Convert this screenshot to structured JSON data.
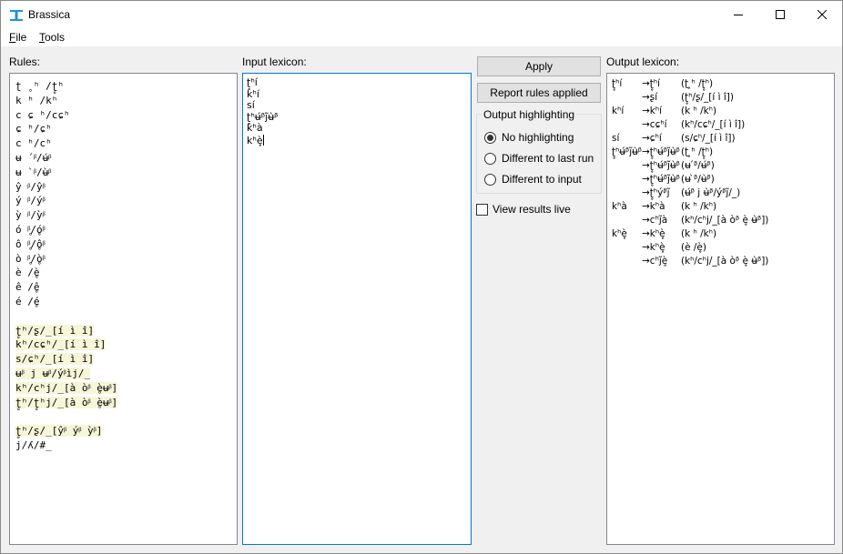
{
  "window": {
    "title": "Brassica",
    "minimize_glyph": "—",
    "maximize_glyph": "☐",
    "close_glyph": "✕"
  },
  "menu": {
    "file": {
      "accel": "F",
      "rest": "ile"
    },
    "tools": {
      "accel": "T",
      "rest": "ools"
    }
  },
  "rules": {
    "label": "Rules:",
    "lines": [
      "ʈ ̥ ʰ /ʈ̥ʰ",
      "k ʰ /kʰ",
      "c ɕ ʰ/cɕʰ",
      "ɕ ʰ/ɕʰ",
      "c ʰ/cʰ",
      "ʉ ́ ᵝ/ʉ́ᵝ",
      "ʉ ̀ ᵝ/ʉ̀ᵝ",
      "ŷ ᵝ/ŷᵝ",
      "ý ᵝ/ýᵝ",
      "ỳ ᵝ/ỳᵝ",
      "ó ̥ᵝ/ó̥ᵝ",
      "ô ̥ᵝ/ô̥ᵝ",
      "ò ̥ᵝ/ò̥ᵝ",
      "è /è̥",
      "ê /ê̥",
      "é /é̥",
      "",
      "ʈ̥ʰ/ʂ/_[í ì î]",
      "kʰ/cɕʰ/_[í ì î]",
      "s/ɕʰ/_[í ì î]",
      "ʉᵝ j ʉᵝ/ýᵝìj/_",
      "kʰ/cʰj/_[à òᵝ è̥ʉᵝ]",
      "ʈ̥ʰ/ʈ̥ʰj/_[à òᵝ è̥ʉᵝ]",
      "",
      "ʈ̥ʰ/ʂ/_[ŷᵝ ýᵝ ỳᵝ]",
      "j/ʎ/#_"
    ]
  },
  "input": {
    "label": "Input lexicon:",
    "lines": [
      "ʈ̥ʰí",
      "kʰí",
      "sí",
      "ʈ̥ʰʉ́ᵝj̃ʉ̀ᵝ",
      "kʰà",
      "kʰè̥"
    ]
  },
  "controls": {
    "apply_label": "Apply",
    "report_label": "Report rules applied",
    "highlight_group": "Output highlighting",
    "options": [
      "No highlighting",
      "Different to last run",
      "Different to input"
    ],
    "selected_option": "No highlighting",
    "live_label": "View results live",
    "live_checked": false
  },
  "output": {
    "label": "Output lexicon:",
    "rows": [
      {
        "word": "ʈ̥ʰí",
        "arrow": "→ʈ̥ʰí",
        "rule": "(ʈ ̥ʰ /ʈ̥ʰ)"
      },
      {
        "word": "",
        "arrow": "→ʂí",
        "rule": "(ʈ̥ʰ/ʂ/_[í ì î])"
      },
      {
        "word": "kʰí",
        "arrow": "→kʰí",
        "rule": "(k ʰ /kʰ)"
      },
      {
        "word": "",
        "arrow": "→cɕʰí",
        "rule": "(kʰ/cɕʰ/_[í ì î])"
      },
      {
        "word": "sí",
        "arrow": "→ɕʰí",
        "rule": "(s/ɕʰ/_[í ì î])"
      },
      {
        "word": "ʈ̥ʰʉ́ᵝj̃ʉ̀ᵝ",
        "arrow": "→ʈ̥ʰʉ́ᵝj̃ʉ̀ᵝ",
        "rule": "(ʈ ̥ʰ /ʈ̥ʰ)"
      },
      {
        "word": "",
        "arrow": "→ʈ̥ʰʉ́ᵝj̃ʉ̀ᵝ",
        "rule": "(ʉ ́ᵝ/ʉ́ᵝ)"
      },
      {
        "word": "",
        "arrow": "→ʈ̥ʰʉ́ᵝj̃ʉ̀ᵝ",
        "rule": "(ʉ ̀ᵝ/ʉ̀ᵝ)"
      },
      {
        "word": "",
        "arrow": "→ʈ̥ʰýᵝj̃",
        "rule": "(ʉ́ᵝ j ʉ̀ᵝ/ýᵝj̃/_)"
      },
      {
        "word": "kʰà",
        "arrow": "→kʰà",
        "rule": "(k ʰ /kʰ)"
      },
      {
        "word": "",
        "arrow": "→cʰj̃à",
        "rule": "(kʰ/cʰj/_[à òᵝ è̥ ʉ̀ᵝ])"
      },
      {
        "word": "kʰè̥",
        "arrow": "→kʰè̥",
        "rule": "(k ʰ /kʰ)"
      },
      {
        "word": "",
        "arrow": "→kʰè̥",
        "rule": "(è /è̥)"
      },
      {
        "word": "",
        "arrow": "→cʰj̃è̥",
        "rule": "(kʰ/cʰj/_[à òᵝ è̥ ʉ̀ᵝ])"
      }
    ]
  },
  "colors": {
    "highlight_bg": "#f8f6d8",
    "focus_border": "#0078d7",
    "icon_blue": "#1e90e0"
  }
}
